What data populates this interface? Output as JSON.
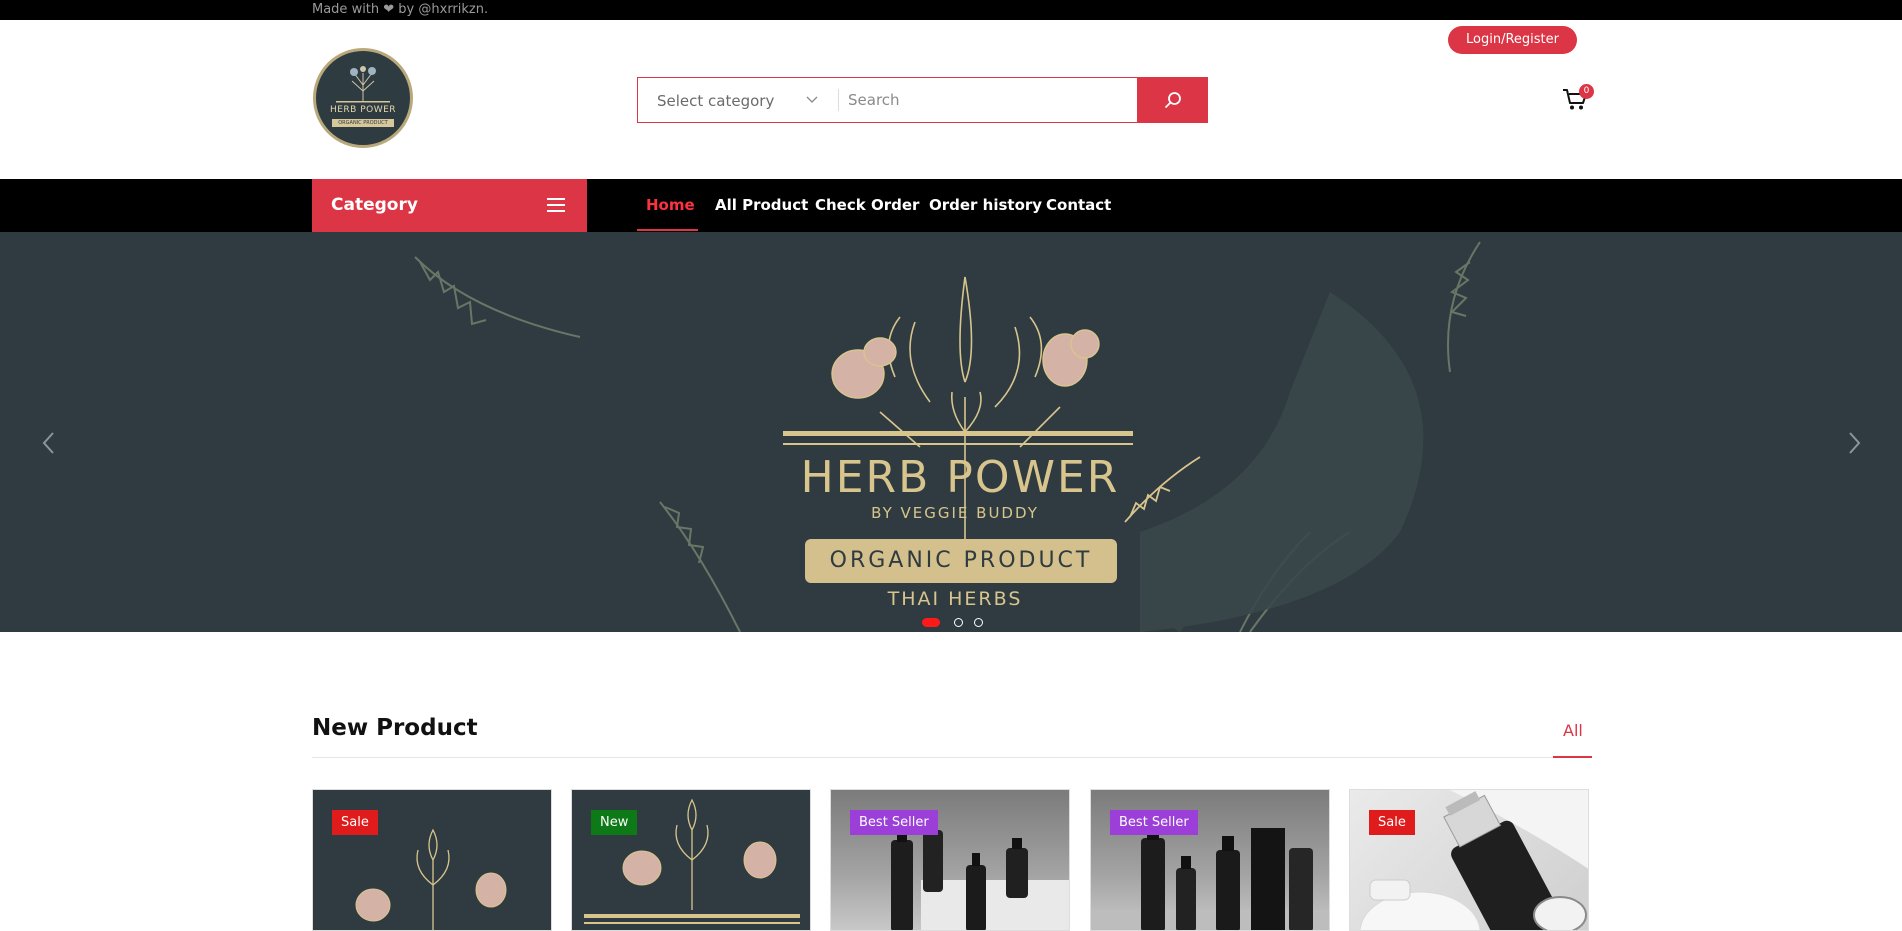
{
  "topbar": {
    "credit": "Made with ❤ by @hxrrikzn."
  },
  "header": {
    "logo": {
      "name": "HERB POWER",
      "tagline": "ORGANIC PRODUCT"
    },
    "search": {
      "category_label": "Select category",
      "placeholder": "Search"
    },
    "login_label": "Login/Register",
    "cart_count": "0"
  },
  "nav": {
    "category_label": "Category",
    "items": [
      {
        "label": "Home",
        "active": true
      },
      {
        "label": "All Product",
        "active": false
      },
      {
        "label": "Check Order",
        "active": false
      },
      {
        "label": "Order history",
        "active": false
      },
      {
        "label": "Contact",
        "active": false
      }
    ]
  },
  "hero": {
    "brand": "HERB POWER",
    "byline": "BY VEGGIE BUDDY",
    "badge": "ORGANIC PRODUCT",
    "subline": "THAI HERBS",
    "slides": 3,
    "active_slide": 1
  },
  "new_product": {
    "title": "New Product",
    "all_link": "All",
    "products": [
      {
        "badge": "Sale",
        "badge_type": "sale",
        "image": "herb-power-logo-art"
      },
      {
        "badge": "New",
        "badge_type": "new",
        "image": "herb-power-logo-art"
      },
      {
        "badge": "Best Seller",
        "badge_type": "best",
        "image": "black-bottles"
      },
      {
        "badge": "Best Seller",
        "badge_type": "best",
        "image": "black-bottles-box"
      },
      {
        "badge": "Sale",
        "badge_type": "sale",
        "image": "cosmetic-jars"
      }
    ]
  },
  "colors": {
    "accent": "#dc3545",
    "hero_bg": "#2f3b40",
    "gold": "#d8c58d"
  }
}
